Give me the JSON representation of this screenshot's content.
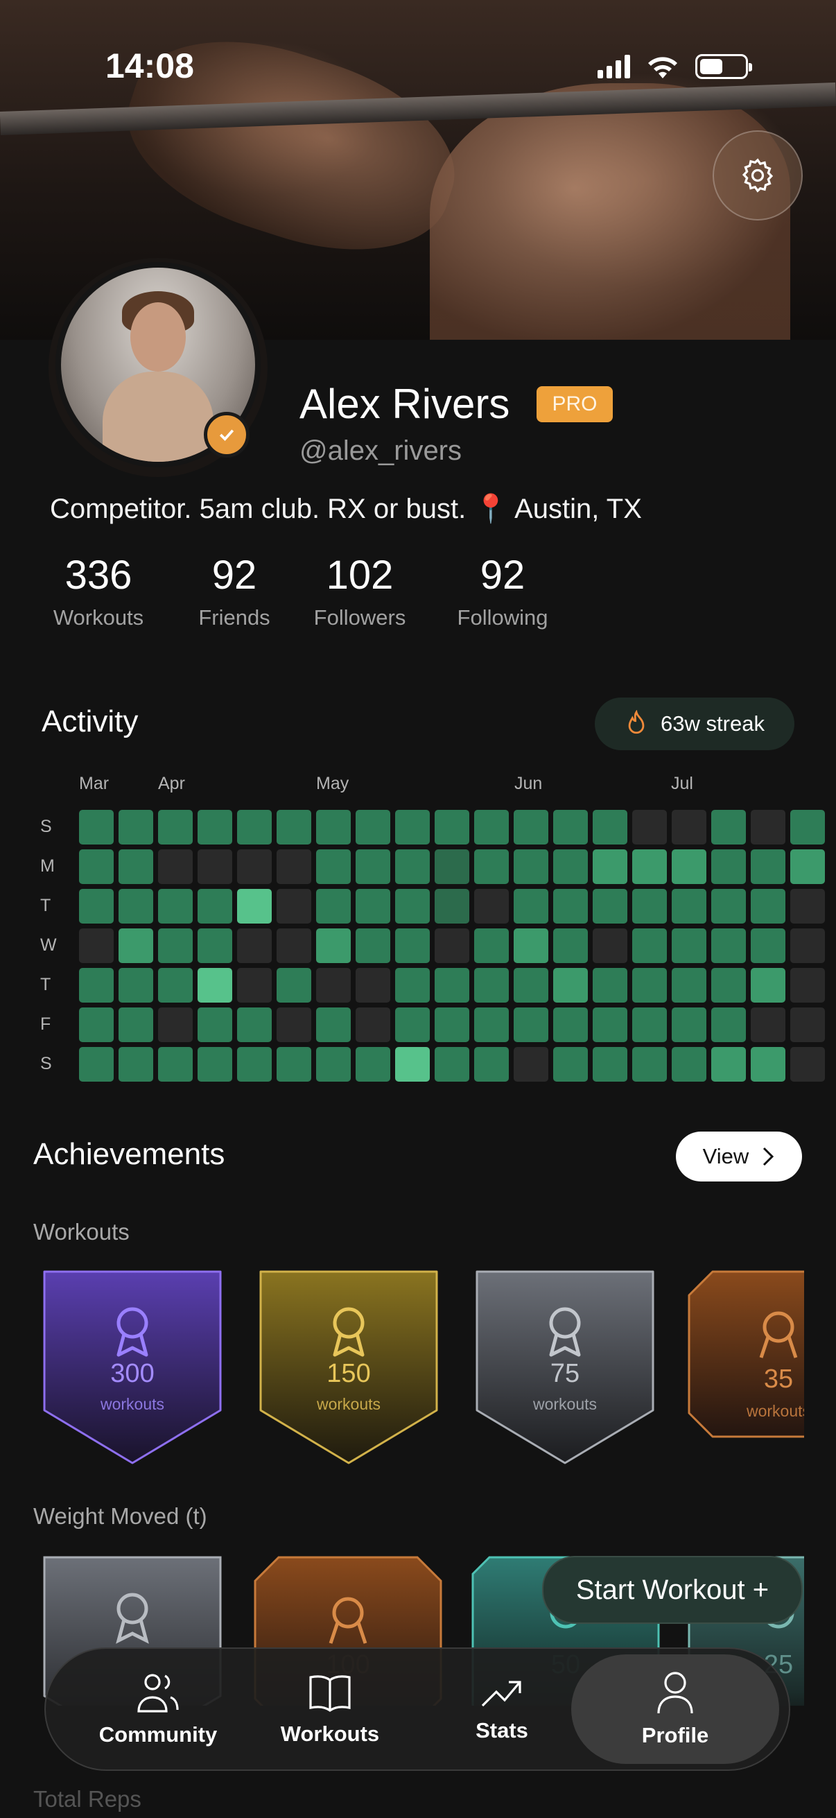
{
  "status_bar": {
    "time": "14:08"
  },
  "profile": {
    "name": "Alex Rivers",
    "badge": "PRO",
    "handle": "@alex_rivers",
    "bio": "Competitor. 5am club. RX or bust. 📍 Austin, TX"
  },
  "stats": [
    {
      "value": "336",
      "label": "Workouts"
    },
    {
      "value": "92",
      "label": "Friends"
    },
    {
      "value": "102",
      "label": "Followers"
    },
    {
      "value": "92",
      "label": "Following"
    }
  ],
  "activity": {
    "title": "Activity",
    "streak": "63w streak",
    "months": [
      "Mar",
      "Apr",
      "May",
      "Jun",
      "Jul"
    ],
    "days": [
      "S",
      "M",
      "T",
      "W",
      "T",
      "F",
      "S"
    ],
    "levels": [
      "2222222222222200202",
      "2200002221222333223",
      "2222402221022222220",
      "0322003220232022220",
      "2224020022223222230",
      "2202202022222222200",
      "2222222242202222330"
    ],
    "colors": {
      "0": "#2a2a2a",
      "1": "#2c6b4c",
      "2": "#2e7d57",
      "3": "#3c9a6b",
      "4": "#57c28b"
    }
  },
  "achievements": {
    "title": "Achievements",
    "view_label": "View",
    "groups": [
      {
        "title": "Workouts",
        "badges": [
          {
            "value": "300",
            "unit": "workouts",
            "color": "#a48cff"
          },
          {
            "value": "150",
            "unit": "workouts",
            "color": "#e8c65a"
          },
          {
            "value": "75",
            "unit": "workouts",
            "color": "#c2c6cc"
          },
          {
            "value": "35",
            "unit": "workouts",
            "color": "#d98b48"
          }
        ]
      },
      {
        "title": "Weight Moved (t)",
        "badges": [
          {
            "value": "",
            "unit": "",
            "color": "#b8bcc2"
          },
          {
            "value": "100",
            "unit": "",
            "color": "#d98b48"
          },
          {
            "value": "50",
            "unit": "",
            "color": "#4ec2b4"
          },
          {
            "value": "25",
            "unit": "",
            "color": "#7ab7b0"
          }
        ]
      }
    ],
    "next_section": "Total Reps"
  },
  "fab": {
    "label": "Start Workout +"
  },
  "tabs": [
    {
      "label": "Community",
      "icon": "community-icon"
    },
    {
      "label": "Workouts",
      "icon": "book-icon"
    },
    {
      "label": "Stats",
      "icon": "trend-icon"
    },
    {
      "label": "Profile",
      "icon": "person-icon",
      "active": true
    }
  ]
}
